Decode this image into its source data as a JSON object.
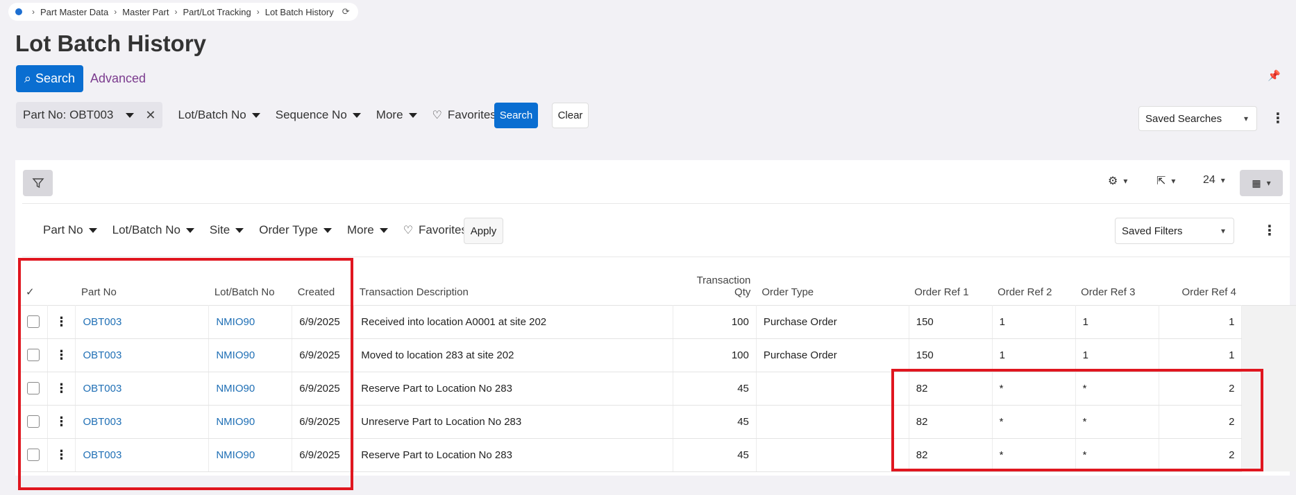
{
  "breadcrumb": [
    "Part Master Data",
    "Master Part",
    "Part/Lot Tracking",
    "Lot Batch History"
  ],
  "page_title": "Lot Batch History",
  "search_label": "Search",
  "advanced_label": "Advanced",
  "filters": {
    "part_chip": "Part No: OBT003",
    "lot_batch": "Lot/Batch No",
    "sequence": "Sequence No",
    "more": "More",
    "favorites": "Favorites",
    "search": "Search",
    "clear": "Clear",
    "saved_searches": "Saved Searches"
  },
  "toolbar": {
    "page_size": "24"
  },
  "inner_filters": {
    "part_no": "Part No",
    "lot_batch": "Lot/Batch No",
    "site": "Site",
    "order_type": "Order Type",
    "more": "More",
    "favorites": "Favorites",
    "apply": "Apply",
    "saved_filters": "Saved Filters"
  },
  "table": {
    "columns": {
      "select": "✓",
      "part_no": "Part No",
      "lot_batch": "Lot/Batch No",
      "created": "Created",
      "description": "Transaction Description",
      "qty_line1": "Transaction",
      "qty_line2": "Qty",
      "order_type": "Order Type",
      "ref1": "Order Ref 1",
      "ref2": "Order Ref 2",
      "ref3": "Order Ref 3",
      "ref4": "Order Ref 4"
    },
    "rows": [
      {
        "part": "OBT003",
        "lot": "NMIO90",
        "created": "6/9/2025",
        "desc": "Received into location A0001 at site 202",
        "qty": "100",
        "order_type": "Purchase Order",
        "ref1": "150",
        "ref2": "1",
        "ref3": "1",
        "ref4": "1"
      },
      {
        "part": "OBT003",
        "lot": "NMIO90",
        "created": "6/9/2025",
        "desc": "Moved to location 283 at site 202",
        "qty": "100",
        "order_type": "Purchase Order",
        "ref1": "150",
        "ref2": "1",
        "ref3": "1",
        "ref4": "1"
      },
      {
        "part": "OBT003",
        "lot": "NMIO90",
        "created": "6/9/2025",
        "desc": "Reserve Part to Location No 283",
        "qty": "45",
        "order_type": "",
        "ref1": "82",
        "ref2": "*",
        "ref3": "*",
        "ref4": "2"
      },
      {
        "part": "OBT003",
        "lot": "NMIO90",
        "created": "6/9/2025",
        "desc": "Unreserve Part to Location No 283",
        "qty": "45",
        "order_type": "",
        "ref1": "82",
        "ref2": "*",
        "ref3": "*",
        "ref4": "2"
      },
      {
        "part": "OBT003",
        "lot": "NMIO90",
        "created": "6/9/2025",
        "desc": "Reserve Part to Location No 283",
        "qty": "45",
        "order_type": "",
        "ref1": "82",
        "ref2": "*",
        "ref3": "*",
        "ref4": "2"
      }
    ]
  },
  "colors": {
    "primary": "#0a6ed1",
    "link": "#1f6fb5",
    "advanced": "#7b3b8e",
    "highlight": "#e0161f"
  }
}
